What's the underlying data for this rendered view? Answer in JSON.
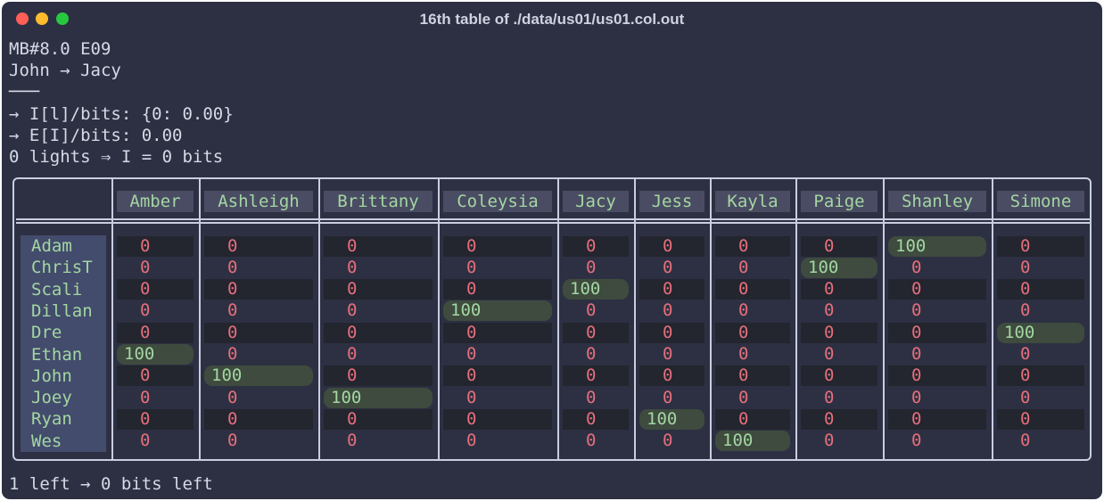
{
  "window": {
    "title": "16th table of ./data/us01/us01.col.out"
  },
  "header_lines": [
    "MB#8.0 E09",
    "John → Jacy",
    "───",
    "→ I[l]/bits: {0: 0.00}",
    "→ E[I]/bits: 0.00",
    "0 lights ⇒ I = 0 bits"
  ],
  "table": {
    "columns": [
      "Amber",
      "Ashleigh",
      "Brittany",
      "Coleysia",
      "Jacy",
      "Jess",
      "Kayla",
      "Paige",
      "Shanley",
      "Simone"
    ],
    "rows": [
      {
        "name": "Adam",
        "values": [
          "0",
          "0",
          "0",
          "0",
          "0",
          "0",
          "0",
          "0",
          "100",
          "0"
        ]
      },
      {
        "name": "ChrisT",
        "values": [
          "0",
          "0",
          "0",
          "0",
          "0",
          "0",
          "0",
          "100",
          "0",
          "0"
        ]
      },
      {
        "name": "Scali",
        "values": [
          "0",
          "0",
          "0",
          "0",
          "100",
          "0",
          "0",
          "0",
          "0",
          "0"
        ]
      },
      {
        "name": "Dillan",
        "values": [
          "0",
          "0",
          "0",
          "100",
          "0",
          "0",
          "0",
          "0",
          "0",
          "0"
        ]
      },
      {
        "name": "Dre",
        "values": [
          "0",
          "0",
          "0",
          "0",
          "0",
          "0",
          "0",
          "0",
          "0",
          "100"
        ]
      },
      {
        "name": "Ethan",
        "values": [
          "100",
          "0",
          "0",
          "0",
          "0",
          "0",
          "0",
          "0",
          "0",
          "0"
        ]
      },
      {
        "name": "John",
        "values": [
          "0",
          "100",
          "0",
          "0",
          "0",
          "0",
          "0",
          "0",
          "0",
          "0"
        ]
      },
      {
        "name": "Joey",
        "values": [
          "0",
          "0",
          "100",
          "0",
          "0",
          "0",
          "0",
          "0",
          "0",
          "0"
        ]
      },
      {
        "name": "Ryan",
        "values": [
          "0",
          "0",
          "0",
          "0",
          "0",
          "100",
          "0",
          "0",
          "0",
          "0"
        ]
      },
      {
        "name": "Wes",
        "values": [
          "0",
          "0",
          "0",
          "0",
          "0",
          "0",
          "100",
          "0",
          "0",
          "0"
        ]
      }
    ]
  },
  "footer_line": "1 left → 0 bits left",
  "colors": {
    "zero": "#e46f7b",
    "hundred": "#a3d6a2",
    "highlight_bg": "#3e4b3e",
    "header_bg": "#4a4c63",
    "name_col_bg": "#434c6c"
  }
}
